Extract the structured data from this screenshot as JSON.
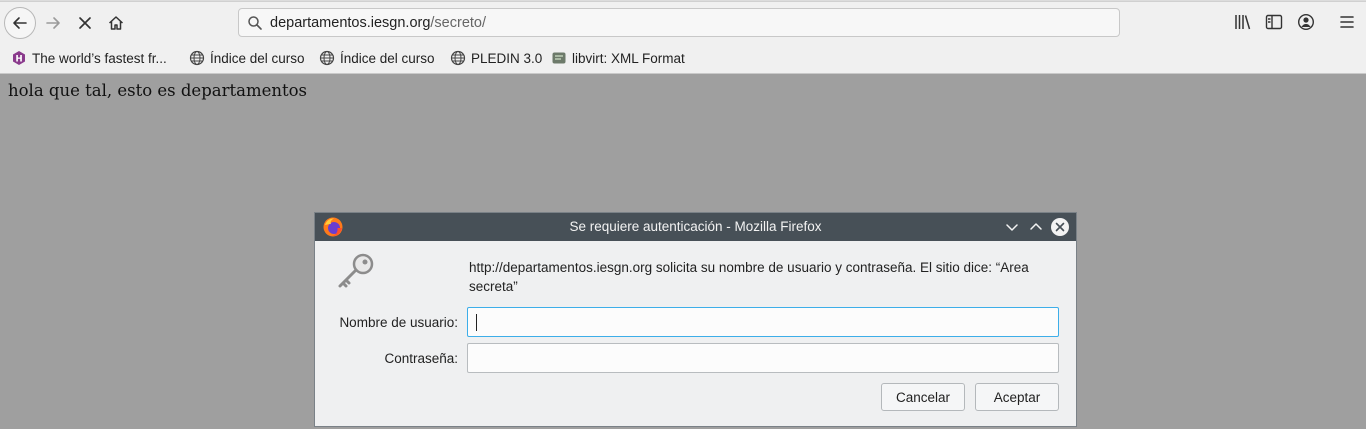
{
  "toolbar": {
    "url_host": "departamentos.iesgn.org",
    "url_path": "/secreto/"
  },
  "bookmarks": [
    {
      "label": "The world’s fastest fr...",
      "icon": "hasura-icon"
    },
    {
      "label": "Índice del curso",
      "icon": "globe-icon"
    },
    {
      "label": "Índice del curso",
      "icon": "globe-icon"
    },
    {
      "label": "PLEDIN 3.0",
      "icon": "globe-icon"
    },
    {
      "label": "libvirt: XML Format",
      "icon": "libvirt-icon"
    }
  ],
  "page": {
    "text": "hola que tal, esto es departamentos"
  },
  "dialog": {
    "title": "Se requiere autenticación - Mozilla Firefox",
    "message": "http://departamentos.iesgn.org solicita su nombre de usuario y contraseña. El sitio dice: “Area secreta”",
    "username_label": "Nombre de usuario:",
    "username_value": "",
    "password_label": "Contraseña:",
    "password_value": "",
    "cancel_label": "Cancelar",
    "accept_label": "Aceptar"
  },
  "colors": {
    "titlebar": "#475057",
    "focus": "#3daee9",
    "overlay": "#9f9f9f"
  }
}
